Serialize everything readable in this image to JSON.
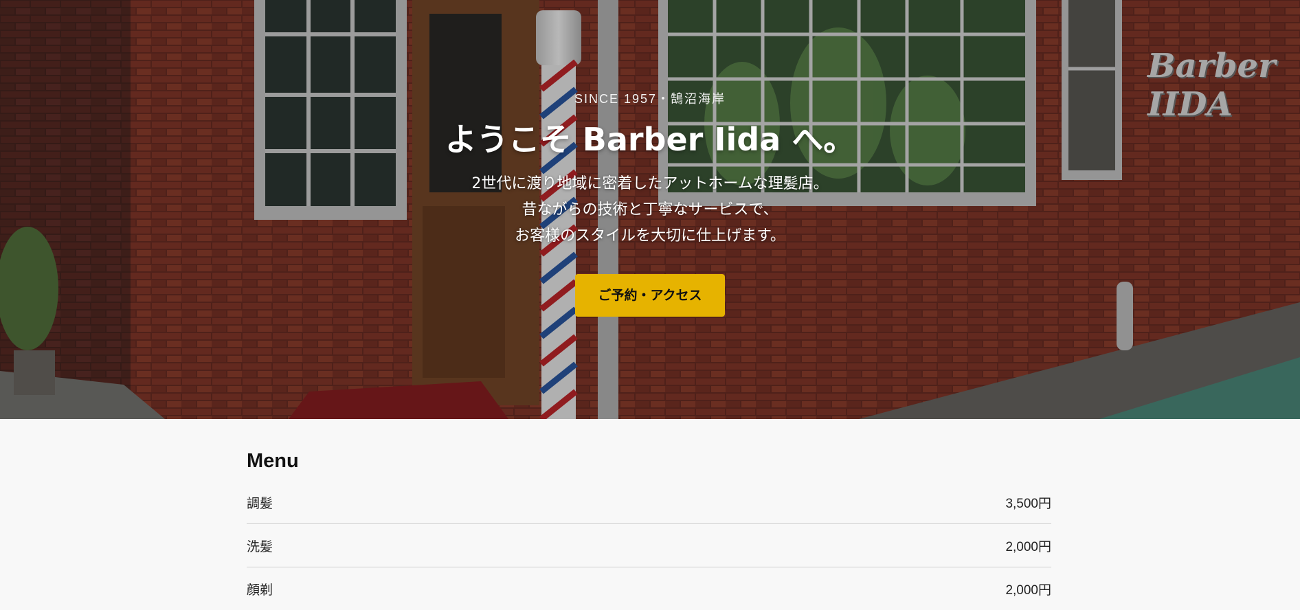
{
  "hero": {
    "since": "SINCE 1957・鵠沼海岸",
    "heading": "ようこそ Barber Iida へ。",
    "tagline": [
      "2世代に渡り地域に密着したアットホームな理髪店。",
      "昔ながらの技術と丁寧なサービスで、",
      "お客様のスタイルを大切に仕上げます。"
    ],
    "cta_label": "ご予約・アクセス",
    "sign_text": "Barber IIDA"
  },
  "menu": {
    "title": "Menu",
    "items": [
      {
        "name": "調髪",
        "price": "3,500円"
      },
      {
        "name": "洗髪",
        "price": "2,000円"
      },
      {
        "name": "顔剃",
        "price": "2,000円"
      }
    ]
  },
  "colors": {
    "accent": "#e6b300",
    "brick": "#7a3226",
    "background": "#f8f8f8"
  }
}
